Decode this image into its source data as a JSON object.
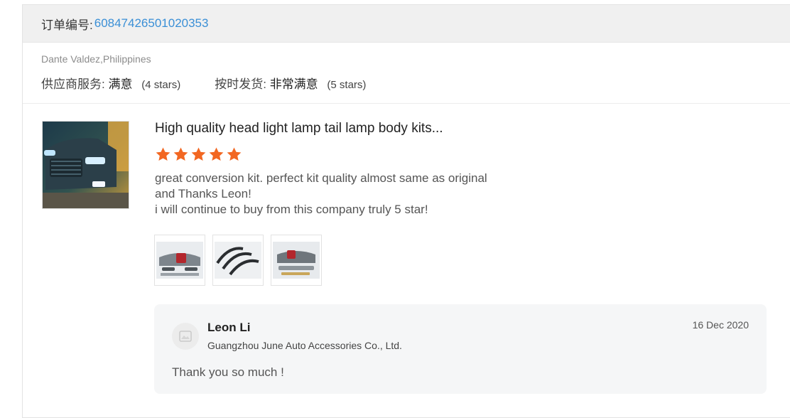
{
  "order": {
    "label": "订单编号:",
    "number": "60847426501020353"
  },
  "buyer": {
    "name_country": "Dante Valdez,Philippines"
  },
  "ratings": [
    {
      "label": "供应商服务:",
      "value": "满意",
      "stars_text": "(4 stars)"
    },
    {
      "label": "按时发货:",
      "value": "非常满意",
      "stars_text": "(5 stars)"
    }
  ],
  "review": {
    "product_title": "High quality head light lamp tail lamp body kits...",
    "star_rating": 5,
    "star_color": "#f26722",
    "lines": [
      "great conversion kit. perfect kit quality almost same as original",
      "and Thanks Leon!",
      "i will continue to buy from this company truly 5 star!"
    ],
    "images": [
      {
        "icon": "bumper-kit-photo"
      },
      {
        "icon": "fender-flares-photo"
      },
      {
        "icon": "body-kit-photo"
      }
    ]
  },
  "reply": {
    "name": "Leon Li",
    "company": "Guangzhou June Auto Accessories Co., Ltd.",
    "date": "16 Dec 2020",
    "text": "Thank you so much !"
  },
  "colors": {
    "link": "#3a8fd6",
    "reply_bg": "#f5f6f7"
  }
}
